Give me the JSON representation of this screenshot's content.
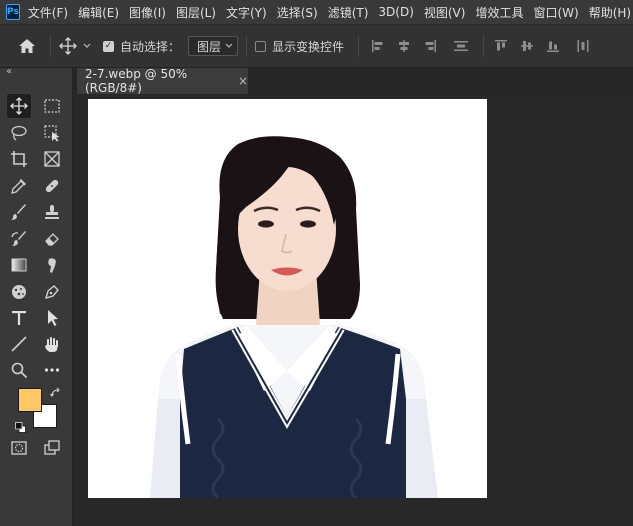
{
  "app": {
    "logo": "Ps"
  },
  "menu": [
    "文件(F)",
    "编辑(E)",
    "图像(I)",
    "图层(L)",
    "文字(Y)",
    "选择(S)",
    "滤镜(T)",
    "3D(D)",
    "视图(V)",
    "增效工具",
    "窗口(W)",
    "帮助(H)"
  ],
  "options": {
    "auto_select_label": "自动选择：",
    "auto_select_checked": true,
    "layer_target": "图层",
    "show_transform_label": "显示变换控件",
    "show_transform_checked": false
  },
  "tabs": [
    {
      "title": "2-7.webp @ 50%(RGB/8#)",
      "close": "×"
    }
  ],
  "toolbar": {
    "collapse": "‹‹",
    "tools": [
      "move-tool",
      "marquee-tool",
      "lasso-tool",
      "object-select-tool",
      "crop-tool",
      "frame-tool",
      "eyedropper-tool",
      "healing-brush-tool",
      "brush-tool",
      "stamp-tool",
      "history-brush-tool",
      "eraser-tool",
      "gradient-tool",
      "smudge-tool",
      "sponge-tool",
      "pen-tool",
      "type-tool",
      "path-select-tool",
      "line-tool",
      "hand-tool",
      "zoom-tool",
      "more-tools"
    ],
    "foreground_color": "#FFC766",
    "background_color": "#FFFFFF"
  },
  "colors": {
    "menubar": "#393939",
    "optionsbar": "#323232",
    "workspace": "#282828",
    "canvas": "#FFFFFF",
    "vest": "#1c2741",
    "hair": "#1a1214"
  }
}
